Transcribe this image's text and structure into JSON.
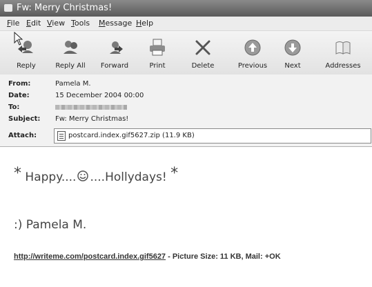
{
  "window": {
    "title": "Fw: Merry Christmas!"
  },
  "menu": [
    {
      "key": "F",
      "rest": "ile"
    },
    {
      "key": "E",
      "rest": "dit"
    },
    {
      "key": "V",
      "rest": "iew"
    },
    {
      "key": "T",
      "rest": "ools"
    },
    {
      "key": "M",
      "rest": "essage"
    },
    {
      "key": "H",
      "rest": "elp"
    }
  ],
  "toolbar": {
    "reply": "Reply",
    "reply_all": "Reply All",
    "forward": "Forward",
    "print": "Print",
    "delete": "Delete",
    "previous": "Previous",
    "next": "Next",
    "addresses": "Addresses"
  },
  "headers": {
    "from_label": "From:",
    "from": "Pamela M.",
    "date_label": "Date:",
    "date": "15 December 2004 00:00",
    "to_label": "To:",
    "subject_label": "Subject:",
    "subject": "Fw: Merry Christmas!",
    "attach_label": "Attach:",
    "attachment": "postcard.index.gif5627.zip (11.9 KB)"
  },
  "message": {
    "star": "*",
    "greeting_left": "Happy....",
    "greeting_right": "....Hollydays!",
    "signature": ":) Pamela M.",
    "link": "http://writeme.com/postcard.index.gif5627",
    "link_suffix": " - Picture Size: 11 KB, Mail: +OK"
  }
}
